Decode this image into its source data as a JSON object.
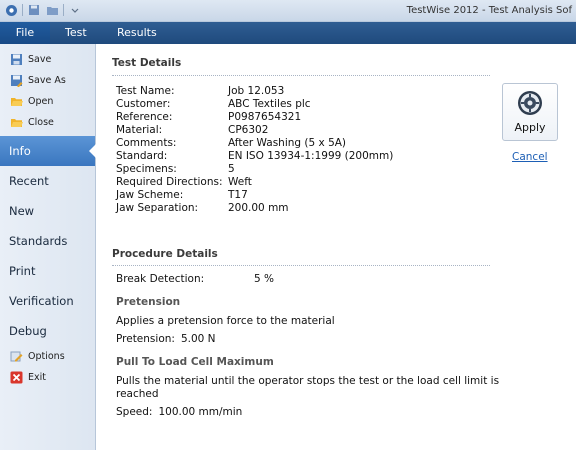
{
  "window": {
    "title": "TestWise 2012 - Test Analysis Sof"
  },
  "tabs": {
    "file": "File",
    "test": "Test",
    "results": "Results"
  },
  "sidebar": {
    "save": "Save",
    "save_as": "Save As",
    "open": "Open",
    "close": "Close",
    "info": "Info",
    "recent": "Recent",
    "new": "New",
    "standards": "Standards",
    "print": "Print",
    "verification": "Verification",
    "debug": "Debug",
    "options": "Options",
    "exit": "Exit"
  },
  "test_details": {
    "heading": "Test Details",
    "rows": [
      {
        "label": "Test Name:",
        "value": "Job 12.053"
      },
      {
        "label": "Customer:",
        "value": "ABC Textiles plc"
      },
      {
        "label": "Reference:",
        "value": "P0987654321"
      },
      {
        "label": "Material:",
        "value": "CP6302"
      },
      {
        "label": "Comments:",
        "value": "After Washing (5 x 5A)"
      },
      {
        "label": "Standard:",
        "value": "EN ISO 13934-1:1999 (200mm)"
      },
      {
        "label": "Specimens:",
        "value": "5"
      },
      {
        "label": "Required Directions:",
        "value": "Weft"
      },
      {
        "label": "Jaw Scheme:",
        "value": "T17"
      },
      {
        "label": "Jaw Separation:",
        "value": "200.00 mm"
      }
    ]
  },
  "procedure": {
    "heading": "Procedure Details",
    "break_label": "Break Detection:",
    "break_value": "5 %",
    "pretension": {
      "heading": "Pretension",
      "description": "Applies a pretension force to the material",
      "label": "Pretension:",
      "value": "5.00 N"
    },
    "pull": {
      "heading": "Pull To Load Cell Maximum",
      "description_line1": "Pulls the material until the operator stops the test or the load cell limit is",
      "description_line2": "reached",
      "label": "Speed:",
      "value": "100.00 mm/min"
    }
  },
  "actions": {
    "apply": "Apply",
    "cancel": "Cancel"
  },
  "colors": {
    "accent": "#3a76bf",
    "ribbon": "#1f4a7d",
    "link": "#1d5fb5"
  }
}
